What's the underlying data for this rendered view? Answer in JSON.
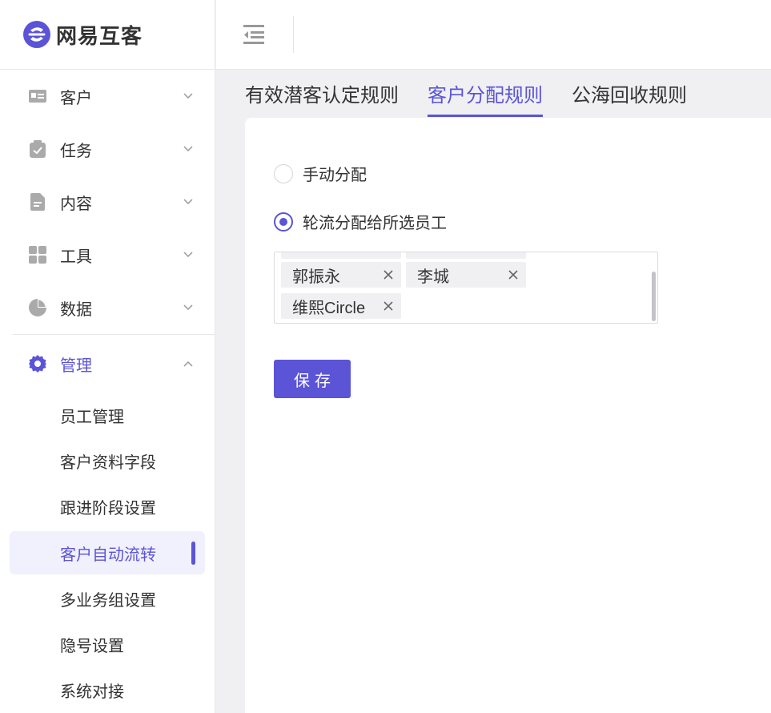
{
  "app": {
    "name": "网易互客",
    "brand_color": "#5b54d6"
  },
  "sidebar": {
    "items": [
      {
        "label": "客户",
        "icon": "id-card-icon"
      },
      {
        "label": "任务",
        "icon": "task-clipboard-icon"
      },
      {
        "label": "内容",
        "icon": "document-icon"
      },
      {
        "label": "工具",
        "icon": "grid-icon"
      },
      {
        "label": "数据",
        "icon": "pie-chart-icon"
      },
      {
        "label": "管理",
        "icon": "gear-icon",
        "expanded": true,
        "active": true
      }
    ],
    "sub_items": [
      {
        "label": "员工管理"
      },
      {
        "label": "客户资料字段"
      },
      {
        "label": "跟进阶段设置"
      },
      {
        "label": "客户自动流转",
        "active": true
      },
      {
        "label": "多业务组设置"
      },
      {
        "label": "隐号设置"
      },
      {
        "label": "系统对接"
      }
    ]
  },
  "tabs": [
    {
      "label": "有效潜客认定规则"
    },
    {
      "label": "客户分配规则",
      "active": true
    },
    {
      "label": "公海回收规则"
    }
  ],
  "form": {
    "options": [
      {
        "label": "手动分配",
        "checked": false
      },
      {
        "label": "轮流分配给所选员工",
        "checked": true
      }
    ],
    "tags": [
      "郭振永",
      "李城",
      "维熙Circle"
    ],
    "save_label": "保存"
  }
}
